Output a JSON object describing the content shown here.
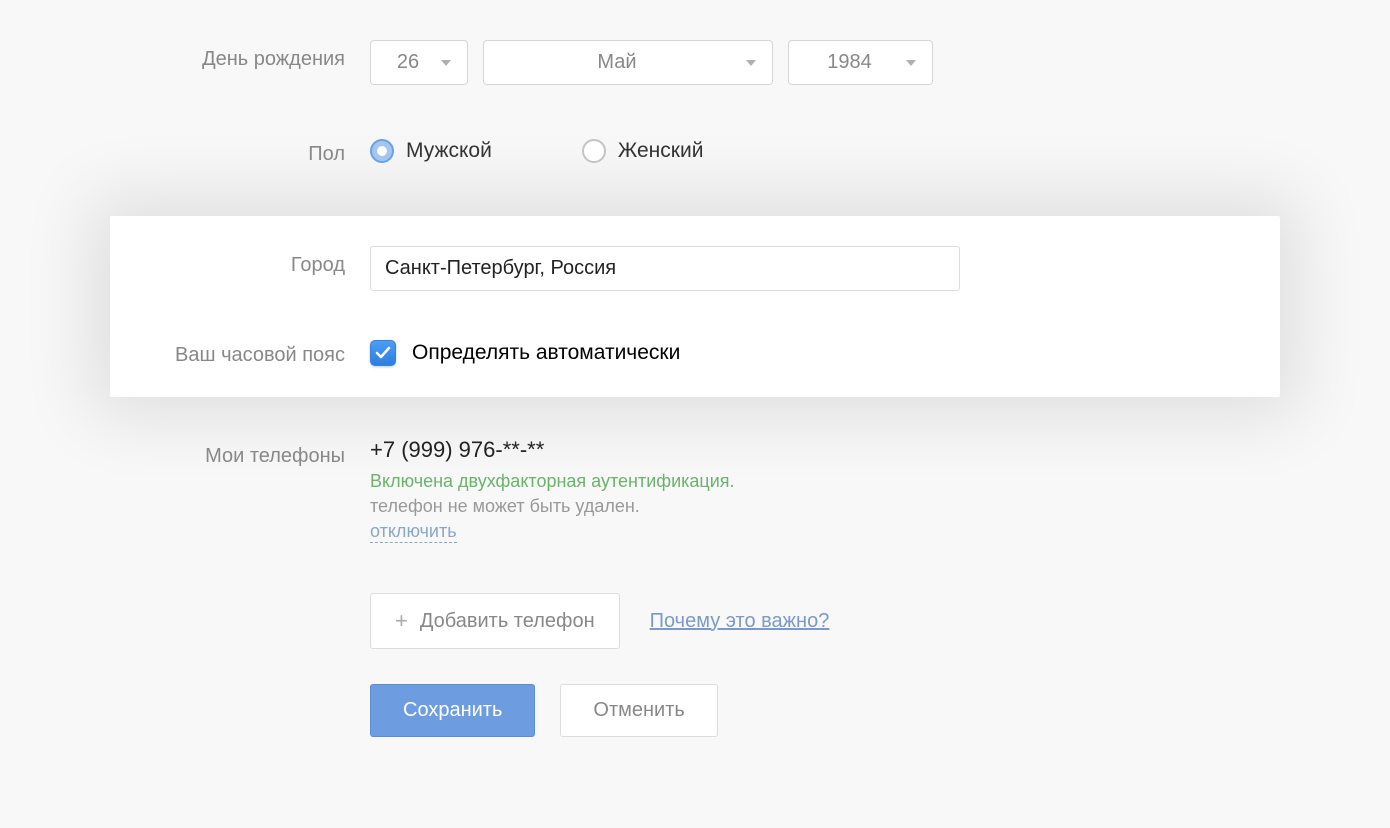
{
  "labels": {
    "birthday": "День рождения",
    "gender": "Пол",
    "city": "Город",
    "timezone": "Ваш часовой пояс",
    "phones": "Мои телефоны"
  },
  "birthday": {
    "day": "26",
    "month": "Май",
    "year": "1984"
  },
  "gender": {
    "male": "Мужской",
    "female": "Женский",
    "selected": "male"
  },
  "city": {
    "value": "Санкт-Петербург, Россия"
  },
  "timezone": {
    "auto_label": "Определять автоматически",
    "auto_checked": true
  },
  "phone": {
    "number": "+7 (999) 976-**-**",
    "two_factor": "Включена двухфакторная аутентификация.",
    "cannot_delete": "телефон не может быть удален.",
    "disable": "отключить",
    "add_label": "Добавить телефон",
    "why_important": "Почему это важно?"
  },
  "buttons": {
    "save": "Сохранить",
    "cancel": "Отменить"
  }
}
